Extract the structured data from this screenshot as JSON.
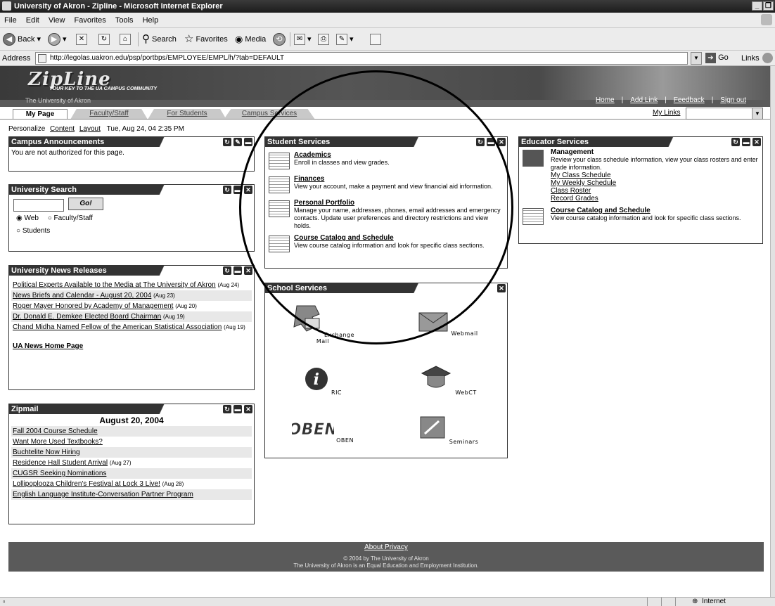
{
  "window": {
    "title": "University of Akron - Zipline - Microsoft Internet Explorer"
  },
  "menu": [
    "File",
    "Edit",
    "View",
    "Favorites",
    "Tools",
    "Help"
  ],
  "toolbar": {
    "back": "Back",
    "search": "Search",
    "favorites": "Favorites",
    "media": "Media"
  },
  "address": {
    "label": "Address",
    "url": "http://legolas.uakron.edu/psp/portbps/EMPLOYEE/EMPL/h/?tab=DEFAULT",
    "go": "Go",
    "links": "Links"
  },
  "banner": {
    "logo": "ZipLine",
    "tagline": "YOUR KEY TO THE UA CAMPUS COMMUNITY",
    "university": "The University of Akron"
  },
  "toplinks": [
    "Home",
    "Add Link",
    "Feedback",
    "Sign out"
  ],
  "tabs": [
    "My Page",
    "Faculty/Staff",
    "For Students",
    "Campus Services"
  ],
  "my_links": "My Links",
  "personalize": {
    "label": "Personalize",
    "content": "Content",
    "layout": "Layout",
    "date": "Tue, Aug 24, 04  2:35 PM"
  },
  "campus_announcements": {
    "title": "Campus Announcements",
    "message": "You are not authorized for this page."
  },
  "university_search": {
    "title": "University Search",
    "go": "Go!",
    "options": [
      "Web",
      "Faculty/Staff",
      "Students"
    ]
  },
  "news": {
    "title": "University News Releases",
    "items": [
      {
        "text": "Political Experts Available to the Media at The University of Akron",
        "date": "(Aug 24)"
      },
      {
        "text": "News Briefs and Calendar - August 20, 2004",
        "date": "(Aug 23)"
      },
      {
        "text": "Roger Mayer Honored by Academy of Management",
        "date": "(Aug 20)"
      },
      {
        "text": "Dr. Donald E. Demkee Elected Board Chairman",
        "date": "(Aug 19)"
      },
      {
        "text": "Chand Midha Named Fellow of the American Statistical Association",
        "date": "(Aug 19)"
      }
    ],
    "home": "UA News Home Page"
  },
  "zipmail": {
    "title": "Zipmail",
    "date": "August 20, 2004",
    "items": [
      {
        "text": "Fall 2004 Course Schedule",
        "date": ""
      },
      {
        "text": "Want More Used Textbooks?",
        "date": ""
      },
      {
        "text": "Buchtelite Now Hiring",
        "date": ""
      },
      {
        "text": "Residence Hall Student Arrival",
        "date": "(Aug 27)"
      },
      {
        "text": "CUGSR Seeking Nominations",
        "date": ""
      },
      {
        "text": "Lollipoplooza Children's Festival at Lock 3 Live!",
        "date": "(Aug 28)"
      },
      {
        "text": "English Language Institute-Conversation Partner Program",
        "date": ""
      }
    ]
  },
  "student_services": {
    "title": "Student Services",
    "items": [
      {
        "title": "Academics",
        "desc": "Enroll in classes and view grades."
      },
      {
        "title": "Finances",
        "desc": "View your account, make a payment and view financial aid information."
      },
      {
        "title": "Personal Portfolio",
        "desc": "Manage your name, addresses, phones, email addresses and emergency contacts. Update user preferences and directory restrictions and view holds."
      },
      {
        "title": "Course Catalog and Schedule",
        "desc": "View course catalog information and look for specific class sections."
      }
    ]
  },
  "school_services": {
    "title": "School Services",
    "items": [
      "Exchange Mail",
      "Webmail",
      "RIC",
      "WebCT",
      "OBEN",
      "Seminars"
    ]
  },
  "educator_services": {
    "title": "Educator Services",
    "management": {
      "title": "Management",
      "desc": "Review your class schedule information, view your class rosters and enter grade information.",
      "links": [
        "My Class Schedule",
        "My Weekly Schedule",
        "Class Roster",
        "Record Grades"
      ]
    },
    "catalog": {
      "title": "Course Catalog and Schedule",
      "desc": "View course catalog information and look for specific class sections."
    }
  },
  "footer": {
    "about": "About Privacy",
    "copyright": "© 2004 by The University of Akron",
    "equal": "The University of Akron is an Equal Education and Employment Institution."
  },
  "status": {
    "zone": "Internet"
  }
}
